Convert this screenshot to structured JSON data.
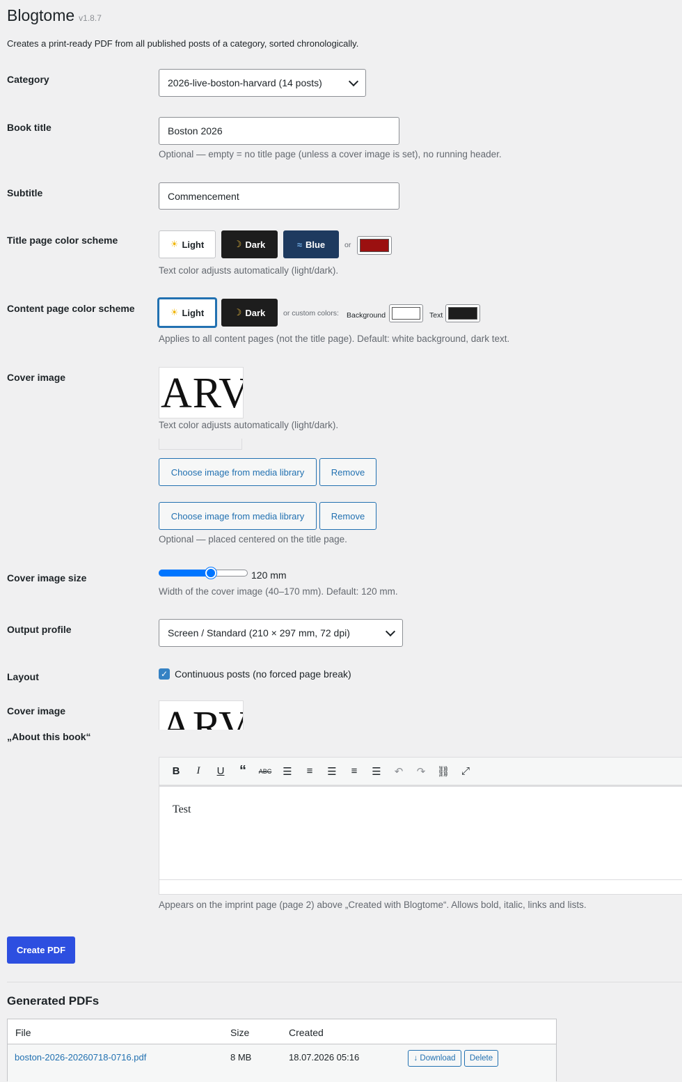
{
  "header": {
    "title": "Blogtome",
    "version": "v1.8.7",
    "description": "Creates a print-ready PDF from all published posts of a category, sorted chronologically."
  },
  "category": {
    "label": "Category",
    "value": "2026-live-boston-harvard (14 posts)"
  },
  "book_title": {
    "label": "Book title",
    "value": "Boston 2026",
    "hint": "Optional — empty = no title page (unless a cover image is set), no running header."
  },
  "subtitle": {
    "label": "Subtitle",
    "value": "Commencement"
  },
  "title_scheme": {
    "label": "Title page color scheme",
    "light": "Light",
    "dark": "Dark",
    "blue": "Blue",
    "or": "or",
    "custom_color": "#9b1010",
    "hint": "Text color adjusts automatically (light/dark)."
  },
  "content_scheme": {
    "label": "Content page color scheme",
    "light": "Light",
    "dark": "Dark",
    "custom_label": "or custom colors:",
    "bg_label": "Background",
    "text_label": "Text",
    "bg_color": "#ffffff",
    "text_color": "#1d1d1d",
    "hint": "Applies to all content pages (not the title page). Default: white background, dark text."
  },
  "cover": {
    "label": "Cover image",
    "thumb_text": "ARV",
    "overlap_hint": "Text color adjusts automatically (light/dark).",
    "choose_label": "Choose image from media library",
    "remove_label": "Remove",
    "hint": "Optional — placed centered on the title page."
  },
  "cover_size": {
    "label": "Cover image size",
    "value_text": "120 mm",
    "fraction": 0.6,
    "hint": "Width of the cover image (40–170 mm). Default: 120 mm."
  },
  "output_profile": {
    "label": "Output profile",
    "value": "Screen / Standard (210 × 297 mm, 72 dpi)"
  },
  "layout": {
    "label": "Layout",
    "checkbox_label": "Continuous posts (no forced page break)",
    "checked": true
  },
  "cover_repeat": {
    "label": "Cover image",
    "thumb_text": "ARV"
  },
  "about": {
    "label": "„About this book“",
    "content": "Test",
    "hint": "Appears on the imprint page (page 2) above „Created with Blogtome“. Allows bold, italic, links and lists.",
    "toolbar_icons": [
      "bold-icon",
      "italic-icon",
      "underline-icon",
      "quote-icon",
      "strikethrough-icon",
      "bullet-list-icon",
      "numbered-list-icon",
      "align-left-icon",
      "align-center-icon",
      "align-right-icon",
      "undo-icon",
      "redo-icon",
      "link-icon",
      "fullscreen-icon"
    ]
  },
  "create_button": "Create PDF",
  "generated": {
    "title": "Generated PDFs",
    "columns": [
      "File",
      "Size",
      "Created"
    ],
    "rows": [
      {
        "file": "boston-2026-20260718-0716.pdf",
        "size": "8 MB",
        "created": "18.07.2026 05:16",
        "download": "↓ Download",
        "delete": "Delete"
      }
    ]
  }
}
